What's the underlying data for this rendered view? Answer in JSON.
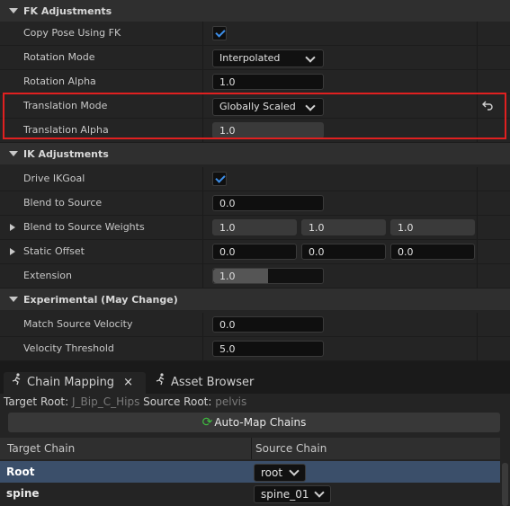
{
  "sections": {
    "fk": "FK Adjustments",
    "ik": "IK Adjustments",
    "experimental": "Experimental (May Change)"
  },
  "fk": {
    "copy_pose_label": "Copy Pose Using FK",
    "copy_pose_checked": true,
    "rotation_mode_label": "Rotation Mode",
    "rotation_mode_value": "Interpolated",
    "rotation_alpha_label": "Rotation Alpha",
    "rotation_alpha_value": "1.0",
    "translation_mode_label": "Translation Mode",
    "translation_mode_value": "Globally Scaled",
    "translation_alpha_label": "Translation Alpha",
    "translation_alpha_value": "1.0"
  },
  "ik": {
    "drive_label": "Drive IKGoal",
    "drive_checked": true,
    "blend_label": "Blend to Source",
    "blend_value": "0.0",
    "blend_weights_label": "Blend to Source Weights",
    "blend_weights": [
      "1.0",
      "1.0",
      "1.0"
    ],
    "static_offset_label": "Static Offset",
    "static_offset": [
      "0.0",
      "0.0",
      "0.0"
    ],
    "extension_label": "Extension",
    "extension_value": "1.0",
    "extension_fill": 0.5
  },
  "experimental": {
    "match_velocity_label": "Match Source Velocity",
    "match_velocity_value": "0.0",
    "velocity_threshold_label": "Velocity Threshold",
    "velocity_threshold_value": "5.0"
  },
  "tabs": {
    "chain_mapping": "Chain Mapping",
    "asset_browser": "Asset Browser"
  },
  "roots": {
    "target_label": "Target Root:",
    "target_value": "J_Bip_C_Hips",
    "source_label": "Source Root:",
    "source_value": "pelvis"
  },
  "automap_label": "Auto-Map Chains",
  "chain_table": {
    "col_target": "Target Chain",
    "col_source": "Source Chain",
    "rows": [
      {
        "target": "Root",
        "source": "root"
      },
      {
        "target": "spine",
        "source": "spine_01"
      }
    ]
  }
}
